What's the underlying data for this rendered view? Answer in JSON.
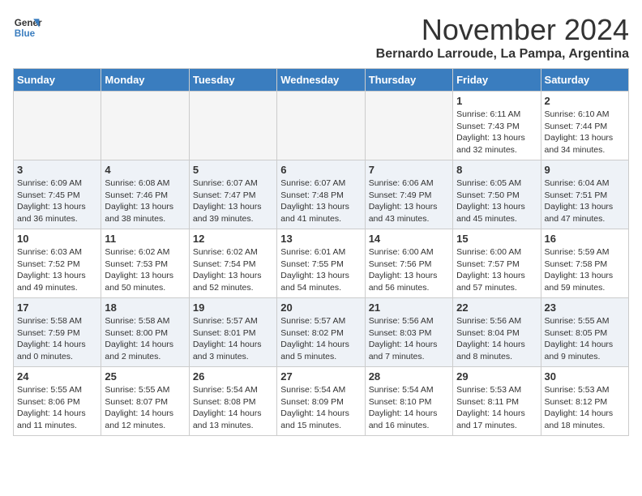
{
  "logo": {
    "line1": "General",
    "line2": "Blue"
  },
  "title": "November 2024",
  "location": "Bernardo Larroude, La Pampa, Argentina",
  "weekdays": [
    "Sunday",
    "Monday",
    "Tuesday",
    "Wednesday",
    "Thursday",
    "Friday",
    "Saturday"
  ],
  "weeks": [
    [
      {
        "day": "",
        "info": ""
      },
      {
        "day": "",
        "info": ""
      },
      {
        "day": "",
        "info": ""
      },
      {
        "day": "",
        "info": ""
      },
      {
        "day": "",
        "info": ""
      },
      {
        "day": "1",
        "info": "Sunrise: 6:11 AM\nSunset: 7:43 PM\nDaylight: 13 hours\nand 32 minutes."
      },
      {
        "day": "2",
        "info": "Sunrise: 6:10 AM\nSunset: 7:44 PM\nDaylight: 13 hours\nand 34 minutes."
      }
    ],
    [
      {
        "day": "3",
        "info": "Sunrise: 6:09 AM\nSunset: 7:45 PM\nDaylight: 13 hours\nand 36 minutes."
      },
      {
        "day": "4",
        "info": "Sunrise: 6:08 AM\nSunset: 7:46 PM\nDaylight: 13 hours\nand 38 minutes."
      },
      {
        "day": "5",
        "info": "Sunrise: 6:07 AM\nSunset: 7:47 PM\nDaylight: 13 hours\nand 39 minutes."
      },
      {
        "day": "6",
        "info": "Sunrise: 6:07 AM\nSunset: 7:48 PM\nDaylight: 13 hours\nand 41 minutes."
      },
      {
        "day": "7",
        "info": "Sunrise: 6:06 AM\nSunset: 7:49 PM\nDaylight: 13 hours\nand 43 minutes."
      },
      {
        "day": "8",
        "info": "Sunrise: 6:05 AM\nSunset: 7:50 PM\nDaylight: 13 hours\nand 45 minutes."
      },
      {
        "day": "9",
        "info": "Sunrise: 6:04 AM\nSunset: 7:51 PM\nDaylight: 13 hours\nand 47 minutes."
      }
    ],
    [
      {
        "day": "10",
        "info": "Sunrise: 6:03 AM\nSunset: 7:52 PM\nDaylight: 13 hours\nand 49 minutes."
      },
      {
        "day": "11",
        "info": "Sunrise: 6:02 AM\nSunset: 7:53 PM\nDaylight: 13 hours\nand 50 minutes."
      },
      {
        "day": "12",
        "info": "Sunrise: 6:02 AM\nSunset: 7:54 PM\nDaylight: 13 hours\nand 52 minutes."
      },
      {
        "day": "13",
        "info": "Sunrise: 6:01 AM\nSunset: 7:55 PM\nDaylight: 13 hours\nand 54 minutes."
      },
      {
        "day": "14",
        "info": "Sunrise: 6:00 AM\nSunset: 7:56 PM\nDaylight: 13 hours\nand 56 minutes."
      },
      {
        "day": "15",
        "info": "Sunrise: 6:00 AM\nSunset: 7:57 PM\nDaylight: 13 hours\nand 57 minutes."
      },
      {
        "day": "16",
        "info": "Sunrise: 5:59 AM\nSunset: 7:58 PM\nDaylight: 13 hours\nand 59 minutes."
      }
    ],
    [
      {
        "day": "17",
        "info": "Sunrise: 5:58 AM\nSunset: 7:59 PM\nDaylight: 14 hours\nand 0 minutes."
      },
      {
        "day": "18",
        "info": "Sunrise: 5:58 AM\nSunset: 8:00 PM\nDaylight: 14 hours\nand 2 minutes."
      },
      {
        "day": "19",
        "info": "Sunrise: 5:57 AM\nSunset: 8:01 PM\nDaylight: 14 hours\nand 3 minutes."
      },
      {
        "day": "20",
        "info": "Sunrise: 5:57 AM\nSunset: 8:02 PM\nDaylight: 14 hours\nand 5 minutes."
      },
      {
        "day": "21",
        "info": "Sunrise: 5:56 AM\nSunset: 8:03 PM\nDaylight: 14 hours\nand 7 minutes."
      },
      {
        "day": "22",
        "info": "Sunrise: 5:56 AM\nSunset: 8:04 PM\nDaylight: 14 hours\nand 8 minutes."
      },
      {
        "day": "23",
        "info": "Sunrise: 5:55 AM\nSunset: 8:05 PM\nDaylight: 14 hours\nand 9 minutes."
      }
    ],
    [
      {
        "day": "24",
        "info": "Sunrise: 5:55 AM\nSunset: 8:06 PM\nDaylight: 14 hours\nand 11 minutes."
      },
      {
        "day": "25",
        "info": "Sunrise: 5:55 AM\nSunset: 8:07 PM\nDaylight: 14 hours\nand 12 minutes."
      },
      {
        "day": "26",
        "info": "Sunrise: 5:54 AM\nSunset: 8:08 PM\nDaylight: 14 hours\nand 13 minutes."
      },
      {
        "day": "27",
        "info": "Sunrise: 5:54 AM\nSunset: 8:09 PM\nDaylight: 14 hours\nand 15 minutes."
      },
      {
        "day": "28",
        "info": "Sunrise: 5:54 AM\nSunset: 8:10 PM\nDaylight: 14 hours\nand 16 minutes."
      },
      {
        "day": "29",
        "info": "Sunrise: 5:53 AM\nSunset: 8:11 PM\nDaylight: 14 hours\nand 17 minutes."
      },
      {
        "day": "30",
        "info": "Sunrise: 5:53 AM\nSunset: 8:12 PM\nDaylight: 14 hours\nand 18 minutes."
      }
    ]
  ]
}
